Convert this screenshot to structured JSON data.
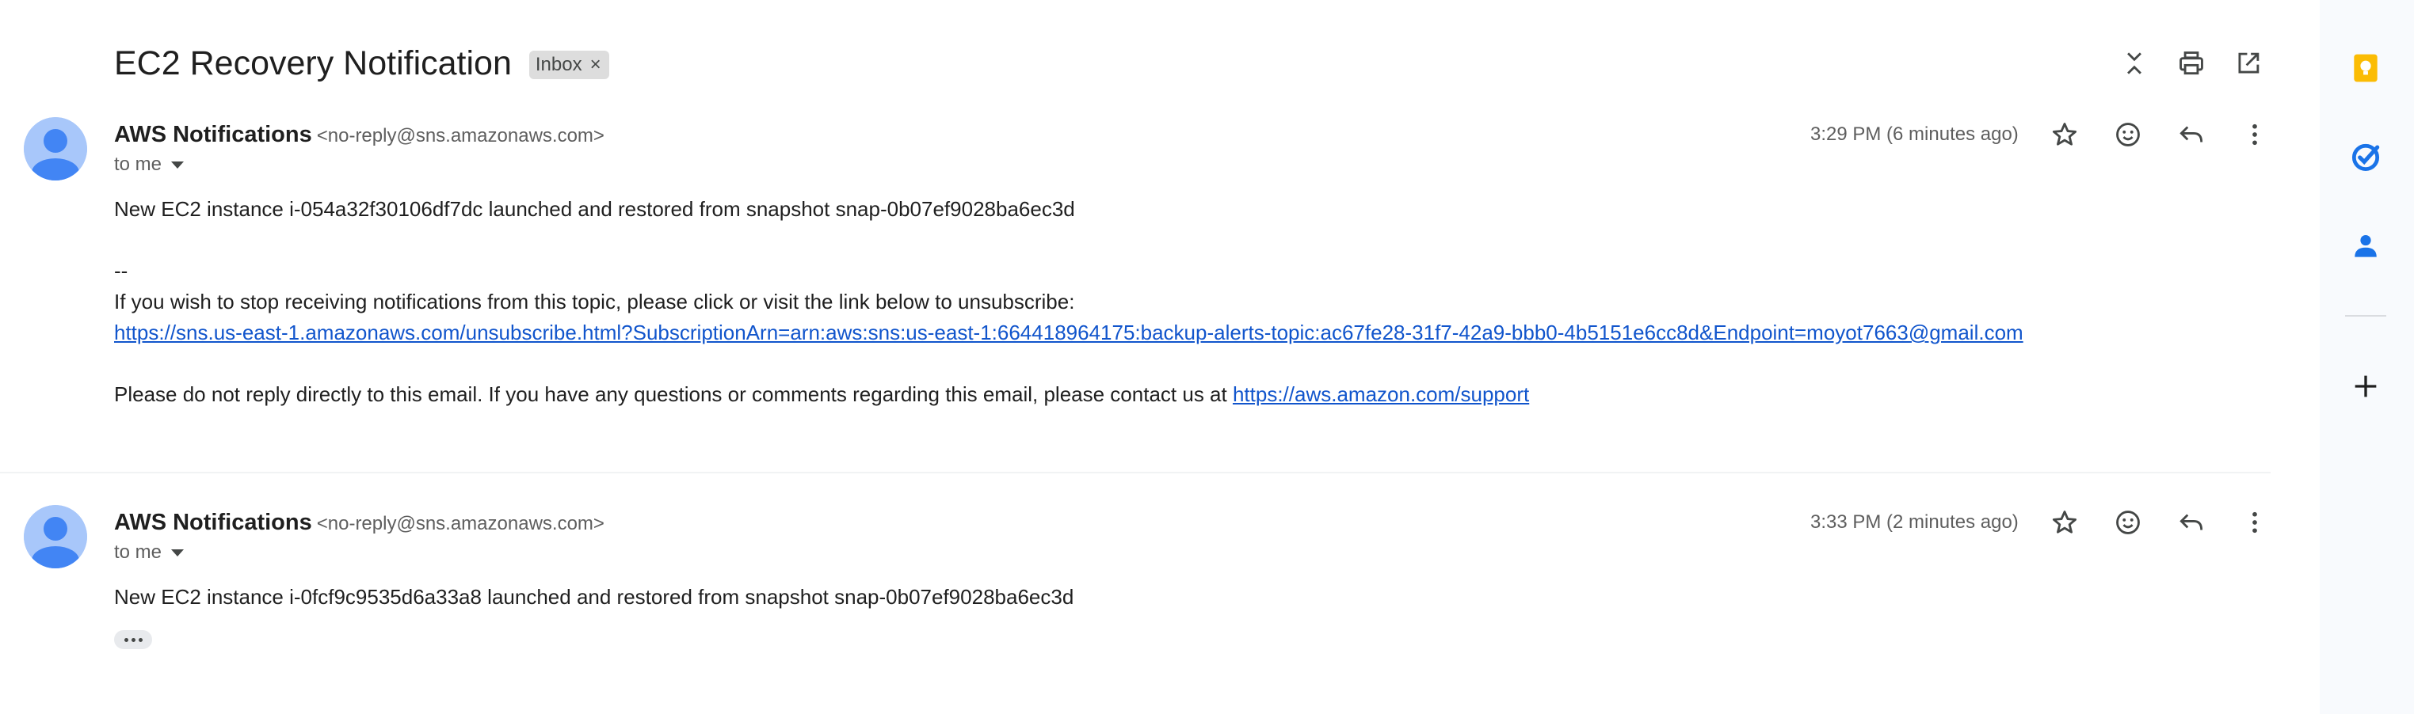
{
  "thread": {
    "subject": "EC2 Recovery Notification",
    "label": "Inbox",
    "label_remove_icon": "close-icon"
  },
  "toolbar_icons": [
    "collapse-all-icon",
    "print-icon",
    "open-in-new-window-icon"
  ],
  "messages": [
    {
      "sender_name": "AWS Notifications",
      "sender_email": "<no-reply@sns.amazonaws.com>",
      "recipient": "to me",
      "time": "3:29 PM (6 minutes ago)",
      "body": "New EC2 instance i-054a32f30106df7dc launched and restored from snapshot snap-0b07ef9028ba6ec3d",
      "signature_sep": "--",
      "unsubscribe_text": "If you wish to stop receiving notifications from this topic, please click or visit the link below to unsubscribe:",
      "unsubscribe_link": "https://sns.us-east-1.amazonaws.com/unsubscribe.html?SubscriptionArn=arn:aws:sns:us-east-1:664418964175:backup-alerts-topic:ac67fe28-31f7-42a9-bbb0-4b5151e6cc8d&Endpoint=moyot7663@gmail.com",
      "noreply_text": "Please do not reply directly to this email. If you have any questions or comments regarding this email, please contact us at ",
      "support_link": "https://aws.amazon.com/support"
    },
    {
      "sender_name": "AWS Notifications",
      "sender_email": "<no-reply@sns.amazonaws.com>",
      "recipient": "to me",
      "time": "3:33 PM (2 minutes ago)",
      "body": "New EC2 instance i-0fcf9c9535d6a33a8 launched and restored from snapshot snap-0b07ef9028ba6ec3d"
    }
  ],
  "message_action_icons": [
    "star-icon",
    "emoji-reaction-icon",
    "reply-icon",
    "more-options-icon"
  ],
  "side_panel": {
    "apps": [
      "keep-icon",
      "tasks-icon",
      "contacts-icon",
      "add-icon"
    ],
    "colors": {
      "keep": "#fbbc04",
      "tasks": "#1a73e8",
      "contacts": "#1a73e8"
    }
  },
  "colors": {
    "link": "#1155cc",
    "avatar_bg": "#a8c7fa",
    "avatar_fg": "#4285f4",
    "chip_bg": "#dddddd"
  }
}
